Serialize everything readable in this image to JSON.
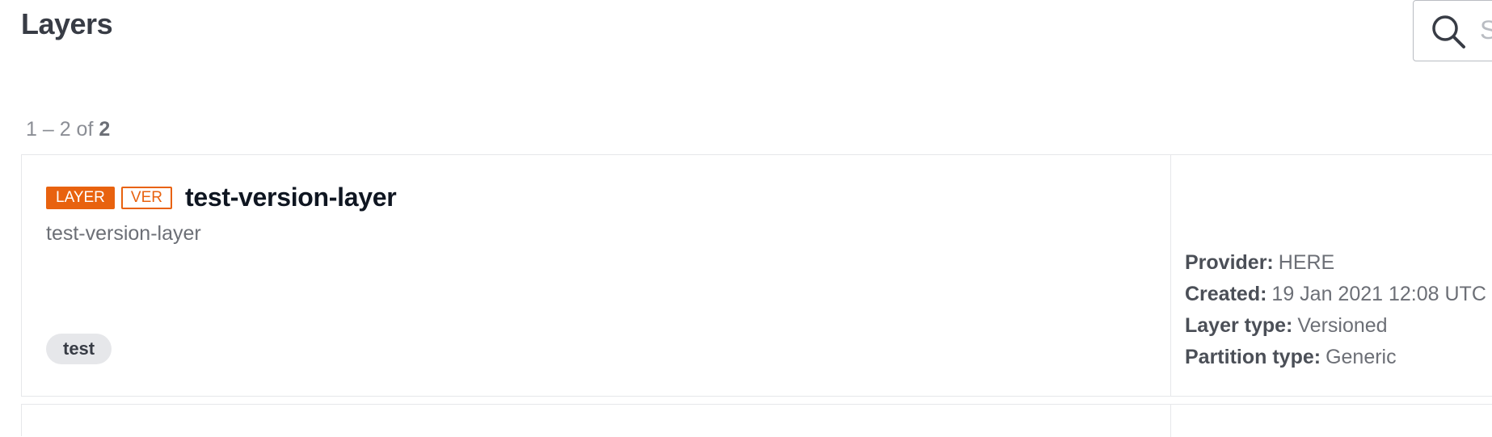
{
  "page": {
    "title": "Layers"
  },
  "search": {
    "placeholder": "S",
    "icon": "search-icon"
  },
  "results": {
    "range": "1 – 2 of ",
    "total": "2"
  },
  "layers": [
    {
      "badges": [
        "LAYER",
        "VER"
      ],
      "title": "test-version-layer",
      "description": "test-version-layer",
      "tags": [
        "test"
      ],
      "meta": {
        "provider_label": "Provider:",
        "provider": "HERE",
        "created_label": "Created:",
        "created": "19 Jan 2021 12:08 UTC",
        "layer_type_label": "Layer type:",
        "layer_type": "Versioned",
        "partition_type_label": "Partition type:",
        "partition_type": "Generic"
      }
    }
  ],
  "colors": {
    "accent": "#e8620f",
    "text": "#383c45",
    "muted": "#6c6f76",
    "border": "#e6e7ea"
  }
}
